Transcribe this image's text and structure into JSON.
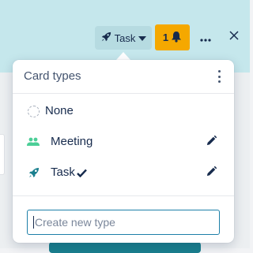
{
  "header": {
    "task_button": {
      "label": "Task",
      "icon": "rocket-icon",
      "caret_icon": "caret-down-icon"
    },
    "notifications": {
      "count": "1",
      "icon": "bell-icon",
      "color": "#f5a800"
    },
    "more_icon": "ellipsis-icon",
    "close_icon": "close-icon"
  },
  "popover": {
    "title": "Card types",
    "menu_icon": "vertical-ellipsis-icon",
    "items": [
      {
        "label": "None",
        "icon": "dashed-circle-icon",
        "editable": false,
        "selected": false
      },
      {
        "label": "Meeting",
        "icon": "people-icon",
        "icon_color": "#4bce97",
        "editable": true,
        "selected": false
      },
      {
        "label": "Task",
        "icon": "rocket-icon",
        "icon_color": "#1a7f8e",
        "editable": true,
        "selected": true
      }
    ],
    "new_type_input": {
      "placeholder": "Create new type",
      "value": ""
    }
  },
  "colors": {
    "header_background": "#c5e7ec",
    "accent_teal": "#1a7f8e"
  }
}
